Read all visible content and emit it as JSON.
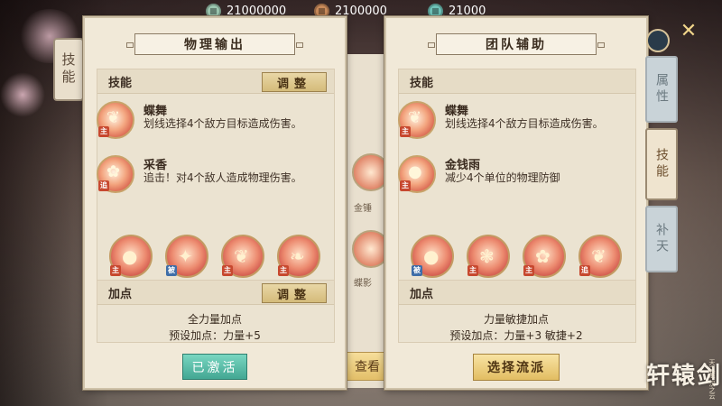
{
  "currencies": [
    {
      "icon": "jade-coin-icon",
      "value": "21000000"
    },
    {
      "icon": "copper-coin-icon",
      "value": "2100000"
    },
    {
      "icon": "teal-coin-icon",
      "value": "21000"
    }
  ],
  "left_tab": {
    "label": "技能"
  },
  "right_tabs": [
    {
      "label": "属性"
    },
    {
      "label": "技能"
    },
    {
      "label": "补天"
    }
  ],
  "close_icon": "✕",
  "logo": {
    "text": "轩辕剑",
    "sub": "天之痕·汉之云"
  },
  "middle_peek": {
    "label1": "金锤",
    "label2": "蝶影",
    "button": "查看"
  },
  "panels": [
    {
      "title": "物理输出",
      "skills_section": {
        "label": "技能",
        "adjust": "调整"
      },
      "skills": [
        {
          "name": "蝶舞",
          "desc": "划线选择4个敌方目标造成伤害。",
          "tag": "主"
        },
        {
          "name": "采香",
          "desc": "追击！对4个敌人造成物理伤害。",
          "tag": "追"
        }
      ],
      "icon_row": [
        {
          "tag": "主"
        },
        {
          "tag": "被"
        },
        {
          "tag": "主"
        },
        {
          "tag": "主"
        }
      ],
      "points_section": {
        "label": "加点",
        "adjust": "调整"
      },
      "points_line1": "全力量加点",
      "points_line2": "预设加点：力量+5",
      "button": "已激活"
    },
    {
      "title": "团队辅助",
      "skills_section": {
        "label": "技能"
      },
      "skills": [
        {
          "name": "蝶舞",
          "desc": "划线选择4个敌方目标造成伤害。",
          "tag": "主"
        },
        {
          "name": "金钱雨",
          "desc": "减少4个单位的物理防御",
          "tag": "主"
        }
      ],
      "icon_row": [
        {
          "tag": "被"
        },
        {
          "tag": "主"
        },
        {
          "tag": "主"
        },
        {
          "tag": "追"
        }
      ],
      "points_section": {
        "label": "加点"
      },
      "points_line1": "力量敏捷加点",
      "points_line2": "预设加点：力量+3 敏捷+2",
      "button": "选择流派"
    }
  ]
}
